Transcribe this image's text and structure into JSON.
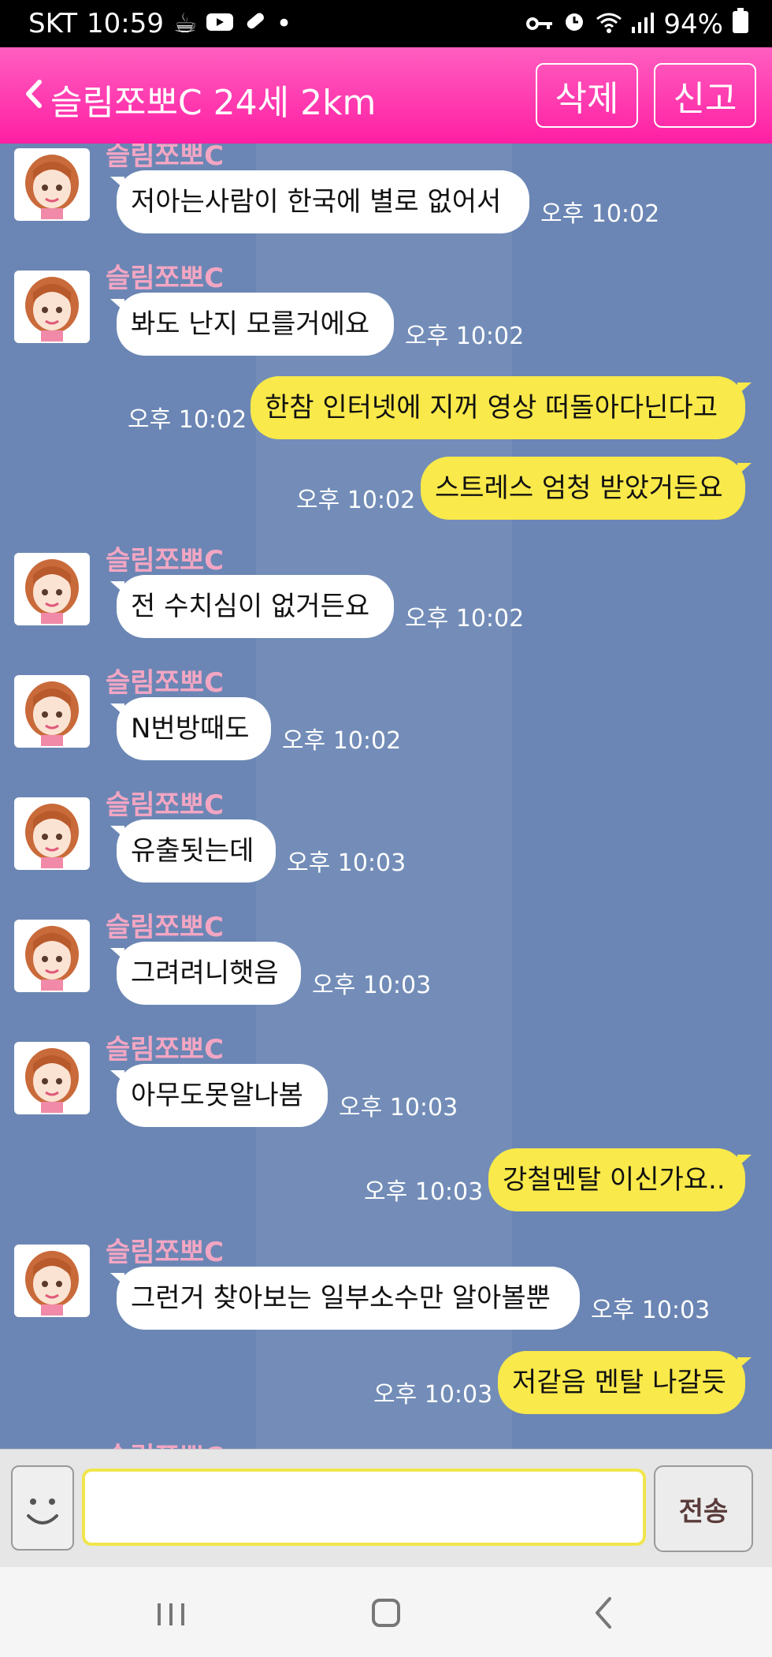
{
  "status": {
    "carrier": "SKT",
    "time": "10:59",
    "battery": "94%"
  },
  "header": {
    "title": "슬림쪼뽀C 24세 2km",
    "delete_label": "삭제",
    "report_label": "신고"
  },
  "messages": [
    {
      "sender": "슬림쪼뽀C",
      "text": "저아는사람이 한국에 별로 없어서",
      "time": "오후 10:02"
    },
    {
      "sender": "슬림쪼뽀C",
      "text": "봐도 난지 모를거에요",
      "time": "오후 10:02"
    },
    {
      "text": "한참 인터넷에 지꺼 영상 떠돌아다닌다고",
      "time": "오후 10:02"
    },
    {
      "text": "스트레스 엄청 받았거든요",
      "time": "오후 10:02"
    },
    {
      "sender": "슬림쪼뽀C",
      "text": "전 수치심이 없거든요",
      "time": "오후 10:02"
    },
    {
      "sender": "슬림쪼뽀C",
      "text": "N번방때도",
      "time": "오후 10:02"
    },
    {
      "sender": "슬림쪼뽀C",
      "text": "유출됫는데",
      "time": "오후 10:03"
    },
    {
      "sender": "슬림쪼뽀C",
      "text": "그려려니햇음",
      "time": "오후 10:03"
    },
    {
      "sender": "슬림쪼뽀C",
      "text": "아무도못알나봄",
      "time": "오후 10:03"
    },
    {
      "text": "강철멘탈 이신가요..",
      "time": "오후 10:03"
    },
    {
      "sender": "슬림쪼뽀C",
      "text": "그런거 찾아보는 일부소수만 알아볼뿐",
      "time": "오후 10:03"
    },
    {
      "text": "저같음 멘탈 나갈듯",
      "time": "오후 10:03"
    },
    {
      "sender": "슬림쪼뽀C"
    }
  ],
  "input": {
    "placeholder": "",
    "send_label": "전송"
  }
}
